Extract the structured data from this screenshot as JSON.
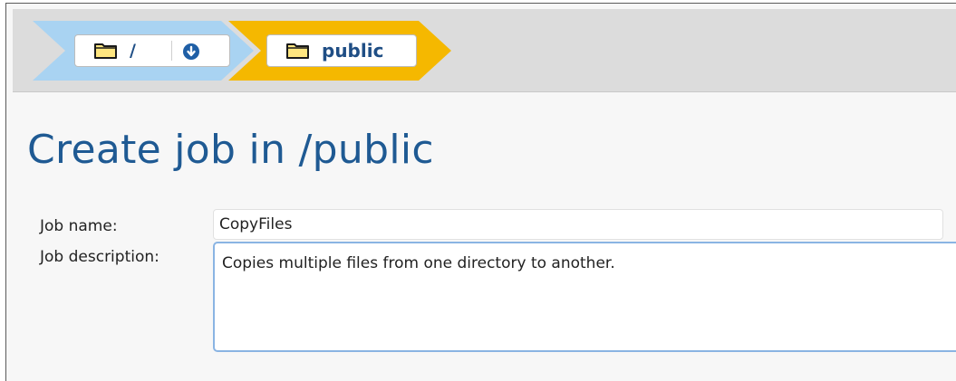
{
  "breadcrumb": {
    "items": [
      {
        "label": "/",
        "icon": "folder-icon",
        "has_dropdown": true,
        "color": "#a9d3f2"
      },
      {
        "label": "public",
        "icon": "folder-icon",
        "has_dropdown": false,
        "color": "#f5b800"
      }
    ]
  },
  "page": {
    "title": "Create job in /public"
  },
  "form": {
    "job_name_label": "Job name:",
    "job_name_value": "CopyFiles",
    "job_description_label": "Job description:",
    "job_description_value": "Copies multiple files from one directory to another."
  },
  "colors": {
    "title": "#1f5a93",
    "link": "#1f4e85",
    "breadcrumb_root": "#a9d3f2",
    "breadcrumb_current": "#f5b800",
    "focus_border": "#8ab4e3",
    "folder_fill": "#ffe680"
  }
}
